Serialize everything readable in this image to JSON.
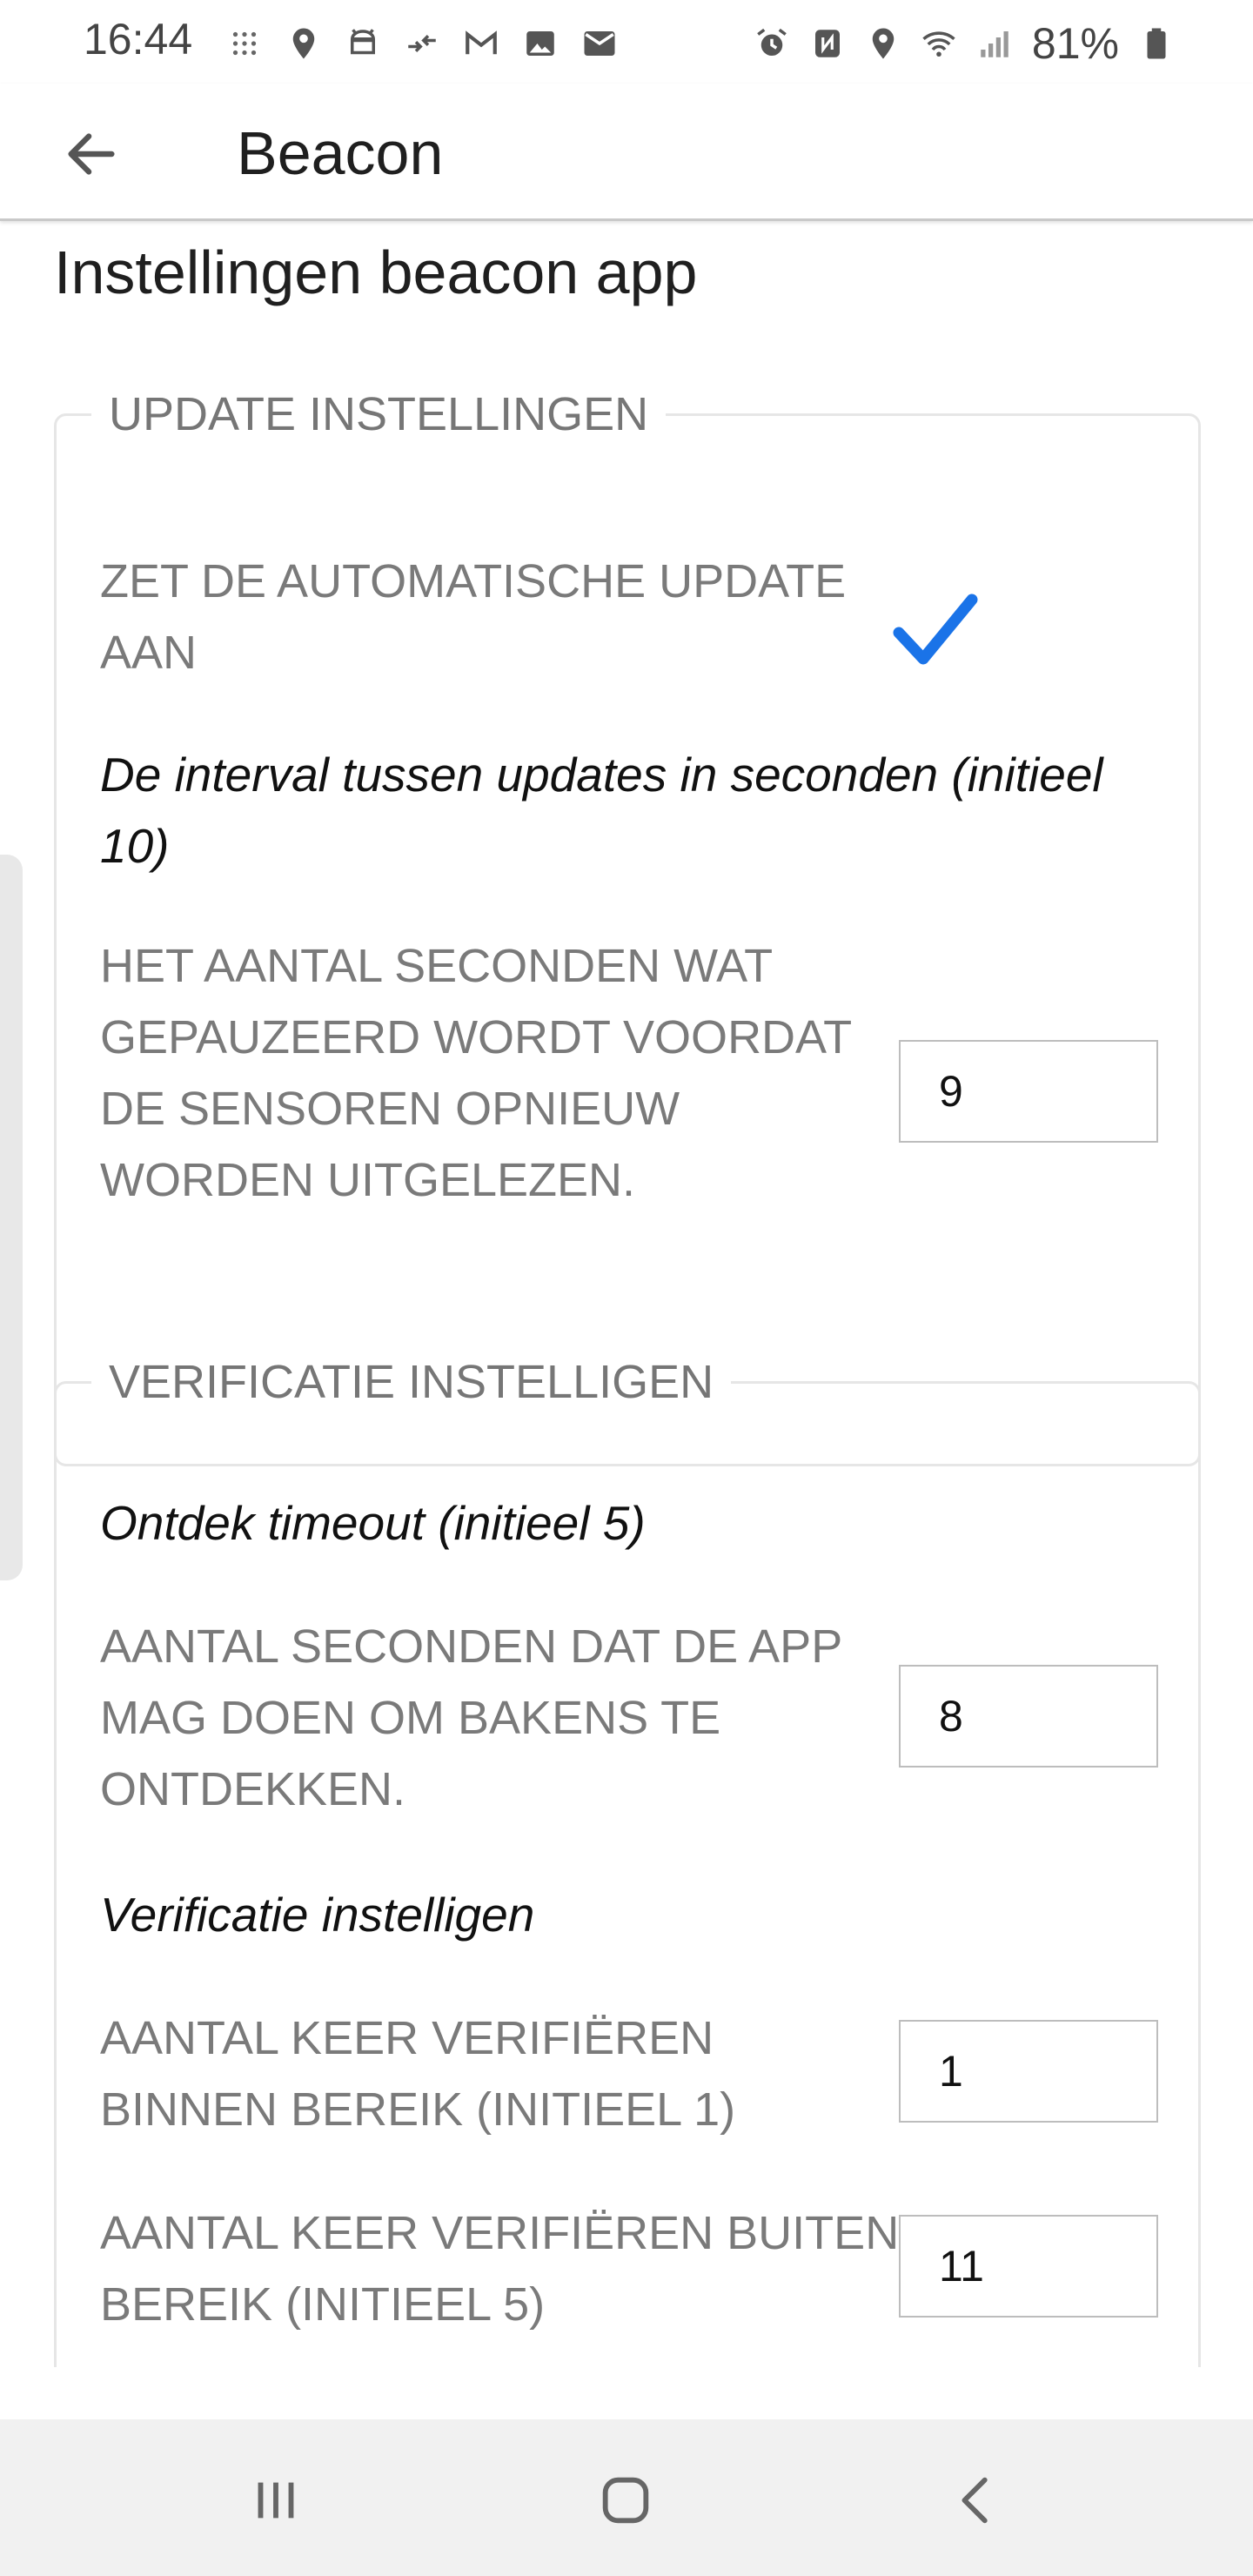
{
  "status_bar": {
    "time": "16:44",
    "battery_percent": "81%",
    "left_icons": [
      "grid-dots-icon",
      "location-pin-icon",
      "android-icon",
      "data-transfer-icon",
      "gmail-icon",
      "image-icon",
      "email-icon"
    ],
    "right_icons": [
      "alarm-icon",
      "nfc-icon",
      "location-icon",
      "wifi-icon",
      "signal-icon",
      "battery-icon"
    ]
  },
  "app_bar": {
    "title": "Beacon"
  },
  "page": {
    "heading": "Instellingen beacon app"
  },
  "update_group": {
    "legend": "UPDATE INSTELLINGEN",
    "auto_update_label": "ZET DE AUTOMATISCHE UPDATE AAN",
    "auto_update_checked": true,
    "interval_heading": "De interval tussen updates in seconden (initieel 10)",
    "pause_label": "HET AANTAL SECONDEN WAT GEPAUZEERD WORDT VOORDAT DE SENSOREN OPNIEUW WORDEN UITGELEZEN.",
    "pause_value": "9"
  },
  "verification_group": {
    "legend": "VERIFICATIE INSTELLIGEN",
    "discover_heading": "Ontdek timeout (initieel 5)",
    "discover_label": "AANTAL SECONDEN DAT DE APP MAG DOEN OM BAKENS TE ONTDEKKEN.",
    "discover_value": "8",
    "verify_heading": "Verificatie instelligen",
    "in_range_label": "AANTAL KEER VERIFIËREN BINNEN BEREIK (INITIEEL 1)",
    "in_range_value": "1",
    "out_range_label": "AANTAL KEER VERIFIËREN BUITEN BEREIK (INITIEEL 5)",
    "out_range_value": "11"
  },
  "colors": {
    "accent_blue": "#1a73e8",
    "label_gray": "#7a7a7a",
    "border_gray": "#e6e6e6"
  }
}
